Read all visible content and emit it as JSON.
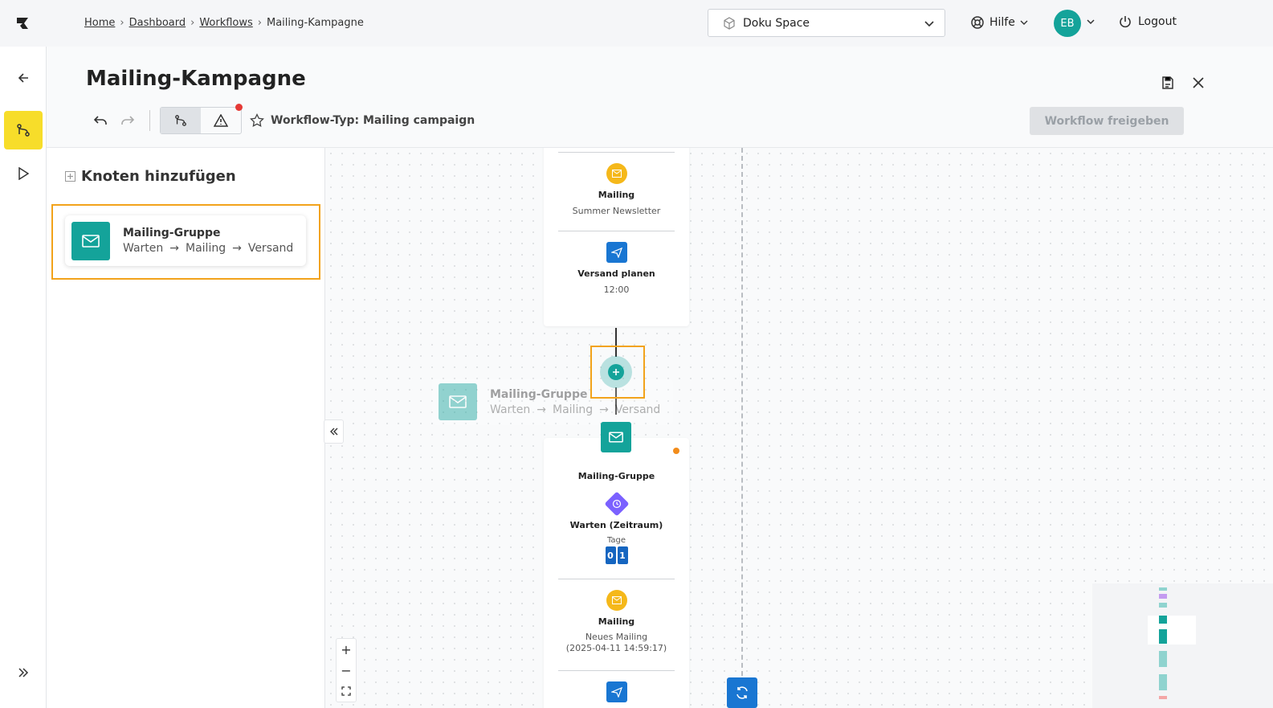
{
  "breadcrumbs": [
    "Home",
    "Dashboard",
    "Workflows",
    "Mailing-Kampagne"
  ],
  "space_select": {
    "value": "Doku Space"
  },
  "help": {
    "label": "Hilfe"
  },
  "user": {
    "initials": "EB"
  },
  "logout": {
    "label": "Logout"
  },
  "page": {
    "title": "Mailing-Kampagne"
  },
  "toolbar": {
    "workflow_type": "Workflow-Typ: Mailing campaign",
    "release_label": "Workflow freigeben"
  },
  "sidepanel": {
    "title": "Knoten hinzufügen",
    "node": {
      "title": "Mailing-Gruppe",
      "steps": [
        "Warten",
        "Mailing",
        "Versand"
      ]
    }
  },
  "canvas": {
    "upper_node": {
      "mailing": {
        "name": "Mailing",
        "sub": "Summer Newsletter"
      },
      "dispatch": {
        "name": "Versand planen",
        "sub": "12:00"
      }
    },
    "ghost": {
      "title": "Mailing-Gruppe",
      "steps": [
        "Warten",
        "Mailing",
        "Versand"
      ]
    },
    "lower_node": {
      "title": "Mailing-Gruppe",
      "wait": {
        "name": "Warten (Zeitraum)",
        "unit": "Tage",
        "digits": [
          "0",
          "1"
        ]
      },
      "mailing": {
        "name": "Mailing",
        "sub": "Neues Mailing",
        "sub2": "(2025-04-11 14:59:17)"
      }
    },
    "zoom": {
      "in": "+",
      "out": "−"
    }
  },
  "colors": {
    "accent_teal": "#14a39a",
    "highlight": "#f2a31b",
    "active_nav": "#f7dd2a",
    "blue": "#1976d2"
  }
}
